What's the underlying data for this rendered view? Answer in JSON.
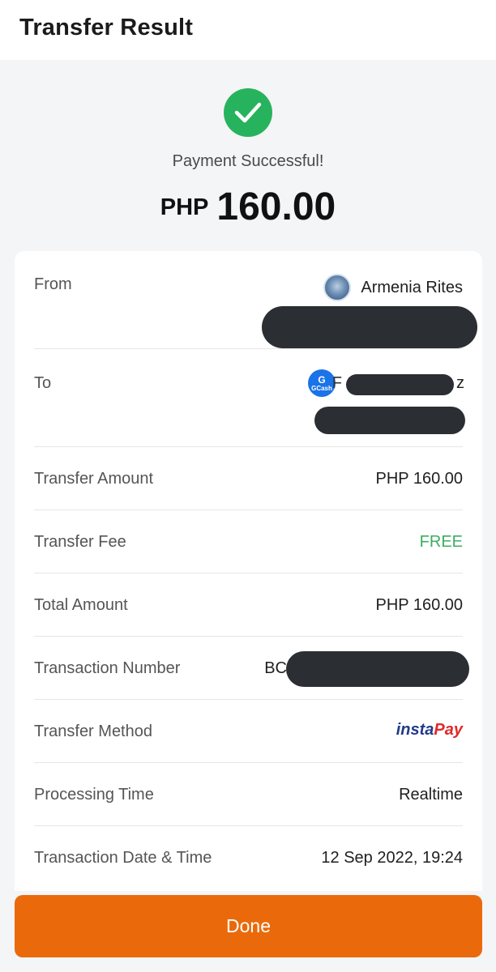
{
  "header": {
    "title": "Transfer Result"
  },
  "result": {
    "status_icon": "check-circle-icon",
    "status_color": "#27b35d",
    "status_text": "Payment Successful!",
    "currency": "PHP",
    "amount": "160.00"
  },
  "details": {
    "from": {
      "label": "From",
      "name": "Armenia Rites",
      "avatar": "bank-logo-icon"
    },
    "to": {
      "label": "To",
      "name_prefix": "F",
      "name_suffix": "z",
      "avatar": "gcash-logo-icon",
      "avatar_text": "G",
      "avatar_subtext": "GCash"
    },
    "transfer_amount": {
      "label": "Transfer Amount",
      "value": "PHP 160.00"
    },
    "transfer_fee": {
      "label": "Transfer Fee",
      "value": "FREE",
      "color": "#3cae63"
    },
    "total_amount": {
      "label": "Total Amount",
      "value": "PHP 160.00"
    },
    "transaction_number": {
      "label": "Transaction Number",
      "prefix": "BC"
    },
    "transfer_method": {
      "label": "Transfer Method",
      "logo_part1": "insta",
      "logo_part2": "Pay"
    },
    "processing_time": {
      "label": "Processing Time",
      "value": "Realtime"
    },
    "transaction_datetime": {
      "label": "Transaction Date & Time",
      "value": "12 Sep 2022, 19:24"
    }
  },
  "footer": {
    "done_label": "Done",
    "accent": "#ea6a0b"
  }
}
